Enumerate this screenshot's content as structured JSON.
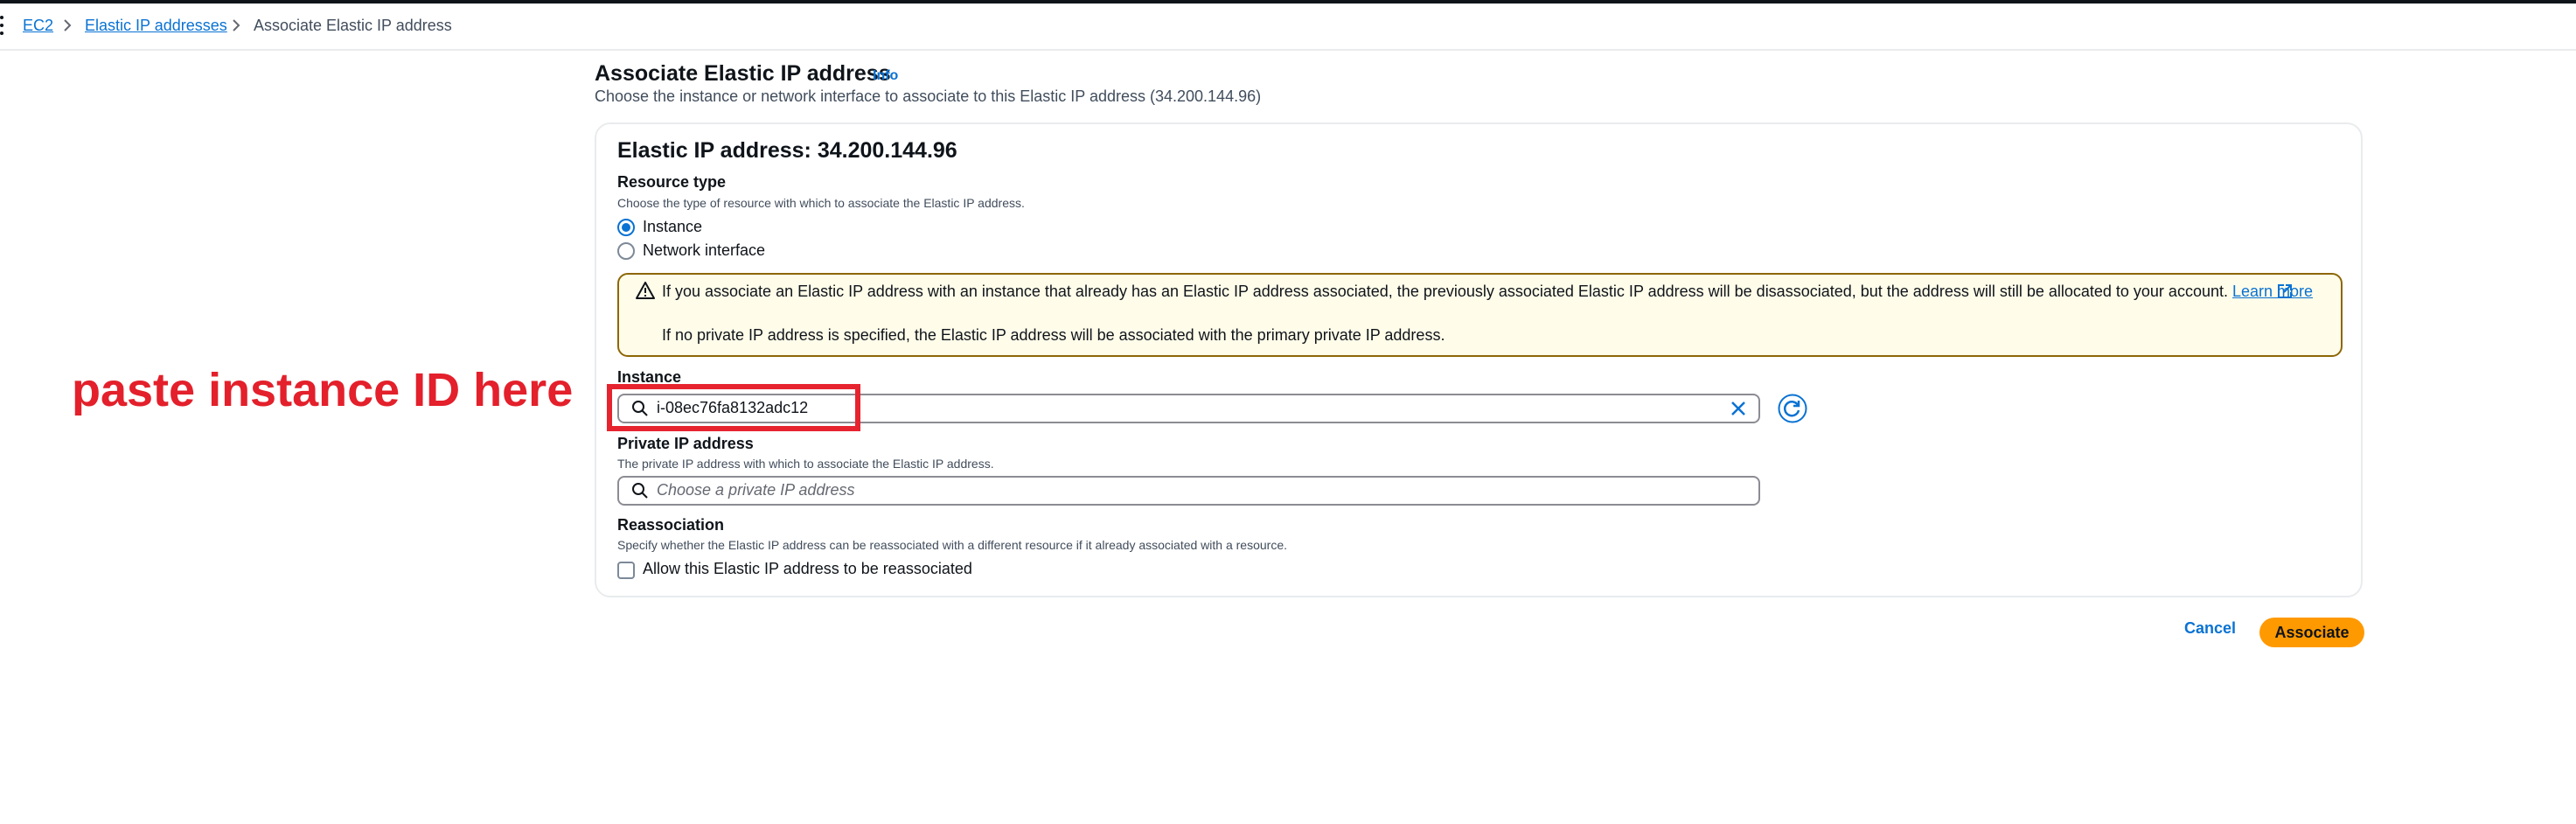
{
  "breadcrumb": {
    "items": [
      "EC2",
      "Elastic IP addresses"
    ],
    "current": "Associate Elastic IP address"
  },
  "header": {
    "title": "Associate Elastic IP address",
    "info_link": "Info",
    "description": "Choose the instance or network interface to associate to this Elastic IP address (34.200.144.96)"
  },
  "card": {
    "title": "Elastic IP address: 34.200.144.96"
  },
  "resource_type": {
    "label": "Resource type",
    "description": "Choose the type of resource with which to associate the Elastic IP address.",
    "options": [
      "Instance",
      "Network interface"
    ],
    "selected": "Instance"
  },
  "alert": {
    "line1": "If you associate an Elastic IP address with an instance that already has an Elastic IP address associated, the previously associated Elastic IP address will be disassociated, but the address will still be allocated to your account.",
    "learn_more": "Learn more",
    "line2": "If no private IP address is specified, the Elastic IP address will be associated with the primary private IP address."
  },
  "instance": {
    "label": "Instance",
    "value": "i-08ec76fa8132adc12"
  },
  "private_ip": {
    "label": "Private IP address",
    "description": "The private IP address with which to associate the Elastic IP address.",
    "placeholder": "Choose a private IP address"
  },
  "reassociation": {
    "label": "Reassociation",
    "description": "Specify whether the Elastic IP address can be reassociated with a different resource if it already associated with a resource.",
    "checkbox_label": "Allow this Elastic IP address to be reassociated",
    "checked": false
  },
  "annotation": {
    "text": "paste instance ID here",
    "color": "#e3202b"
  },
  "actions": {
    "cancel": "Cancel",
    "associate": "Associate"
  },
  "colors": {
    "link": "#0972d3",
    "primary_button": "#ff9900",
    "alert_bg": "#fffce9",
    "alert_border": "#8d6605"
  },
  "icons": [
    "menu-dots-icon",
    "chevron-right-icon",
    "warning-icon",
    "external-link-icon",
    "search-icon",
    "clear-icon",
    "refresh-icon"
  ]
}
